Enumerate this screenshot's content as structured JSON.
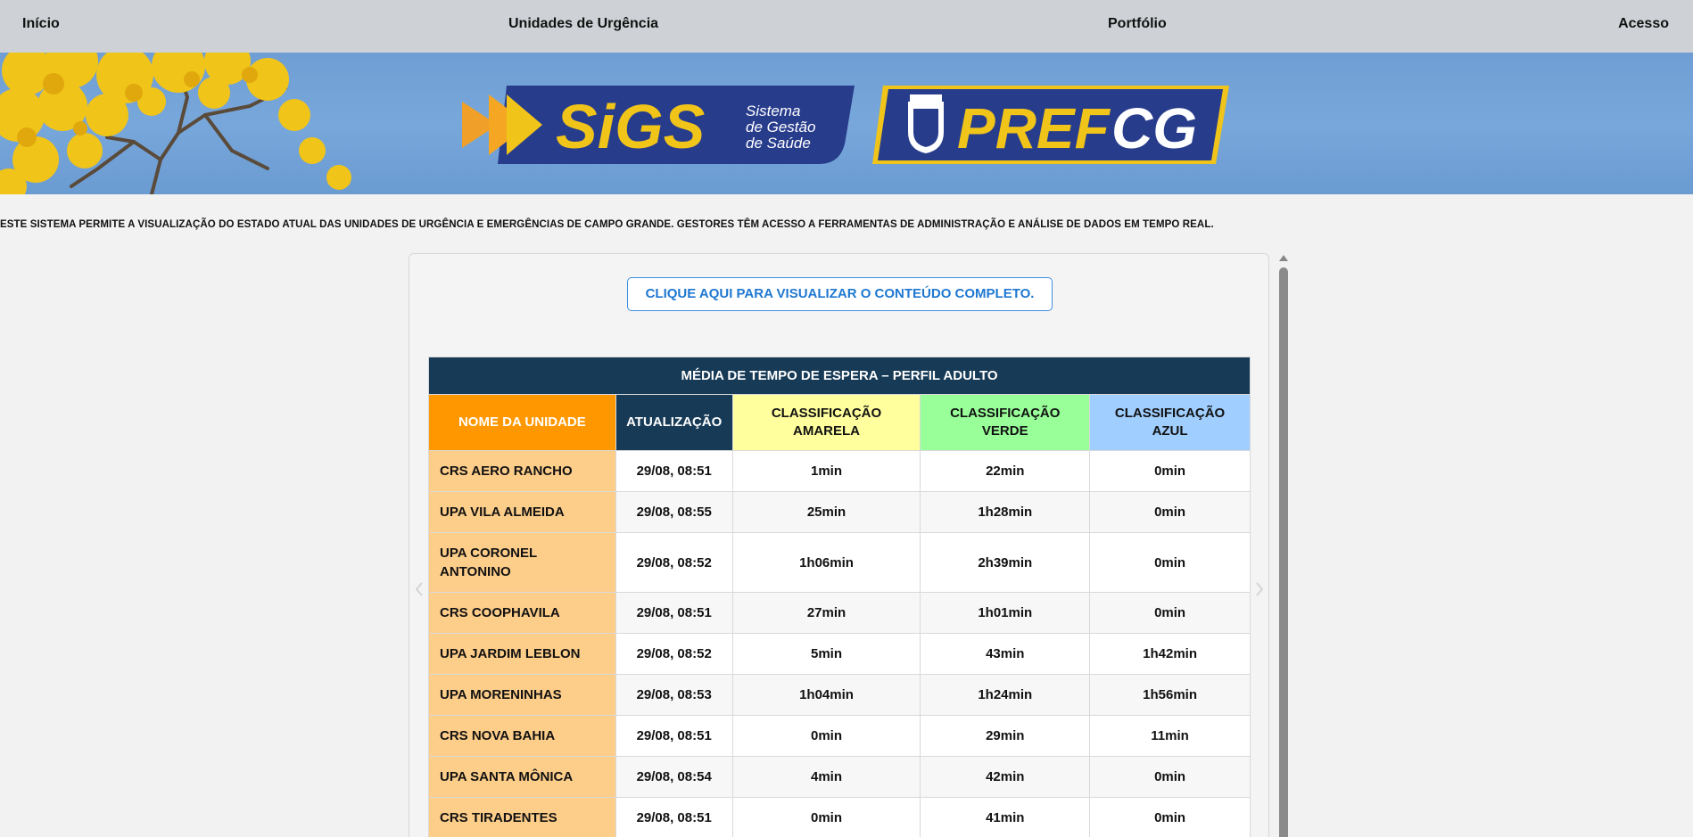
{
  "nav": {
    "home": "Início",
    "units": "Unidades de Urgência",
    "portfolio": "Portfólio",
    "access": "Acesso"
  },
  "banner": {
    "sigs_logo": "SiGS",
    "sigs_subtitle_1": "Sistema",
    "sigs_subtitle_2": "de Gestão",
    "sigs_subtitle_3": "de Saúde",
    "pref_logo_a": "PREF",
    "pref_logo_b": "CG"
  },
  "intro": "ESTE SISTEMA PERMITE A VISUALIZAÇÃO DO ESTADO ATUAL DAS UNIDADES DE URGÊNCIA E EMERGÊNCIAS DE CAMPO GRANDE. GESTORES TÊM ACESSO A FERRAMENTAS DE ADMINISTRAÇÃO E ANÁLISE DE DADOS EM TEMPO REAL.",
  "cta": "CLIQUE AQUI PARA VISUALIZAR O CONTEÚDO COMPLETO.",
  "table": {
    "title": "MÉDIA DE TEMPO DE ESPERA – PERFIL ADULTO",
    "headers": {
      "name": "NOME DA UNIDADE",
      "updated": "ATUALIZAÇÃO",
      "amarela_1": "CLASSIFICAÇÃO",
      "amarela_2": "AMARELA",
      "verde_1": "CLASSIFICAÇÃO",
      "verde_2": "VERDE",
      "azul_1": "CLASSIFICAÇÃO",
      "azul_2": "AZUL"
    },
    "rows": [
      {
        "name": "CRS AERO RANCHO",
        "updated": "29/08, 08:51",
        "amarela": "1min",
        "verde": "22min",
        "azul": "0min"
      },
      {
        "name": "UPA VILA ALMEIDA",
        "updated": "29/08, 08:55",
        "amarela": "25min",
        "verde": "1h28min",
        "azul": "0min"
      },
      {
        "name": "UPA CORONEL ANTONINO",
        "updated": "29/08, 08:52",
        "amarela": "1h06min",
        "verde": "2h39min",
        "azul": "0min"
      },
      {
        "name": "CRS COOPHAVILA",
        "updated": "29/08, 08:51",
        "amarela": "27min",
        "verde": "1h01min",
        "azul": "0min"
      },
      {
        "name": "UPA JARDIM LEBLON",
        "updated": "29/08, 08:52",
        "amarela": "5min",
        "verde": "43min",
        "azul": "1h42min"
      },
      {
        "name": "UPA MORENINHAS",
        "updated": "29/08, 08:53",
        "amarela": "1h04min",
        "verde": "1h24min",
        "azul": "1h56min"
      },
      {
        "name": "CRS NOVA BAHIA",
        "updated": "29/08, 08:51",
        "amarela": "0min",
        "verde": "29min",
        "azul": "11min"
      },
      {
        "name": "UPA SANTA MÔNICA",
        "updated": "29/08, 08:54",
        "amarela": "4min",
        "verde": "42min",
        "azul": "0min"
      },
      {
        "name": "CRS TIRADENTES",
        "updated": "29/08, 08:51",
        "amarela": "0min",
        "verde": "41min",
        "azul": "0min"
      }
    ]
  }
}
